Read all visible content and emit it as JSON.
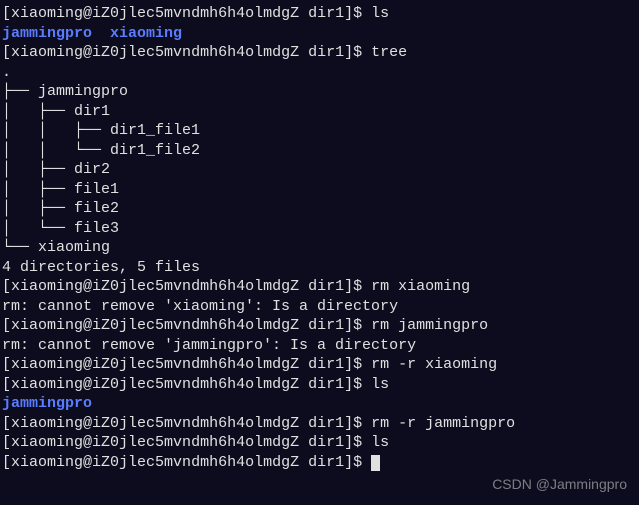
{
  "prompt": {
    "user": "xiaoming",
    "host": "iZ0jlec5mvndmh6h4olmdgZ",
    "cwd": "dir1",
    "open": "[",
    "at": "@",
    "close_cmd": "]$",
    "space": " "
  },
  "cmds": {
    "ls1": "ls",
    "tree": "tree",
    "rm_xiaoming": "rm xiaoming",
    "rm_jammingpro": "rm jammingpro",
    "rm_r_xiaoming": "rm -r xiaoming",
    "ls2": "ls",
    "rm_r_jammingpro": "rm -r jammingpro",
    "ls3": "ls",
    "empty": ""
  },
  "ls_out1": {
    "d1": "jammingpro",
    "sep": "  ",
    "d2": "xiaoming"
  },
  "ls_out2": {
    "d1": "jammingpro"
  },
  "tree_out": {
    "dot": ".",
    "l1": "├── jammingpro",
    "l2": "│   ├── dir1",
    "l3": "│   │   ├── dir1_file1",
    "l4": "│   │   └── dir1_file2",
    "l5": "│   ├── dir2",
    "l6": "│   ├── file1",
    "l7": "│   ├── file2",
    "l8": "│   └── file3",
    "l9": "└── xiaoming",
    "blank": "",
    "summary": "4 directories, 5 files"
  },
  "errors": {
    "e1": "rm: cannot remove 'xiaoming': Is a directory",
    "e2": "rm: cannot remove 'jammingpro': Is a directory"
  },
  "watermark": "CSDN @Jammingpro"
}
